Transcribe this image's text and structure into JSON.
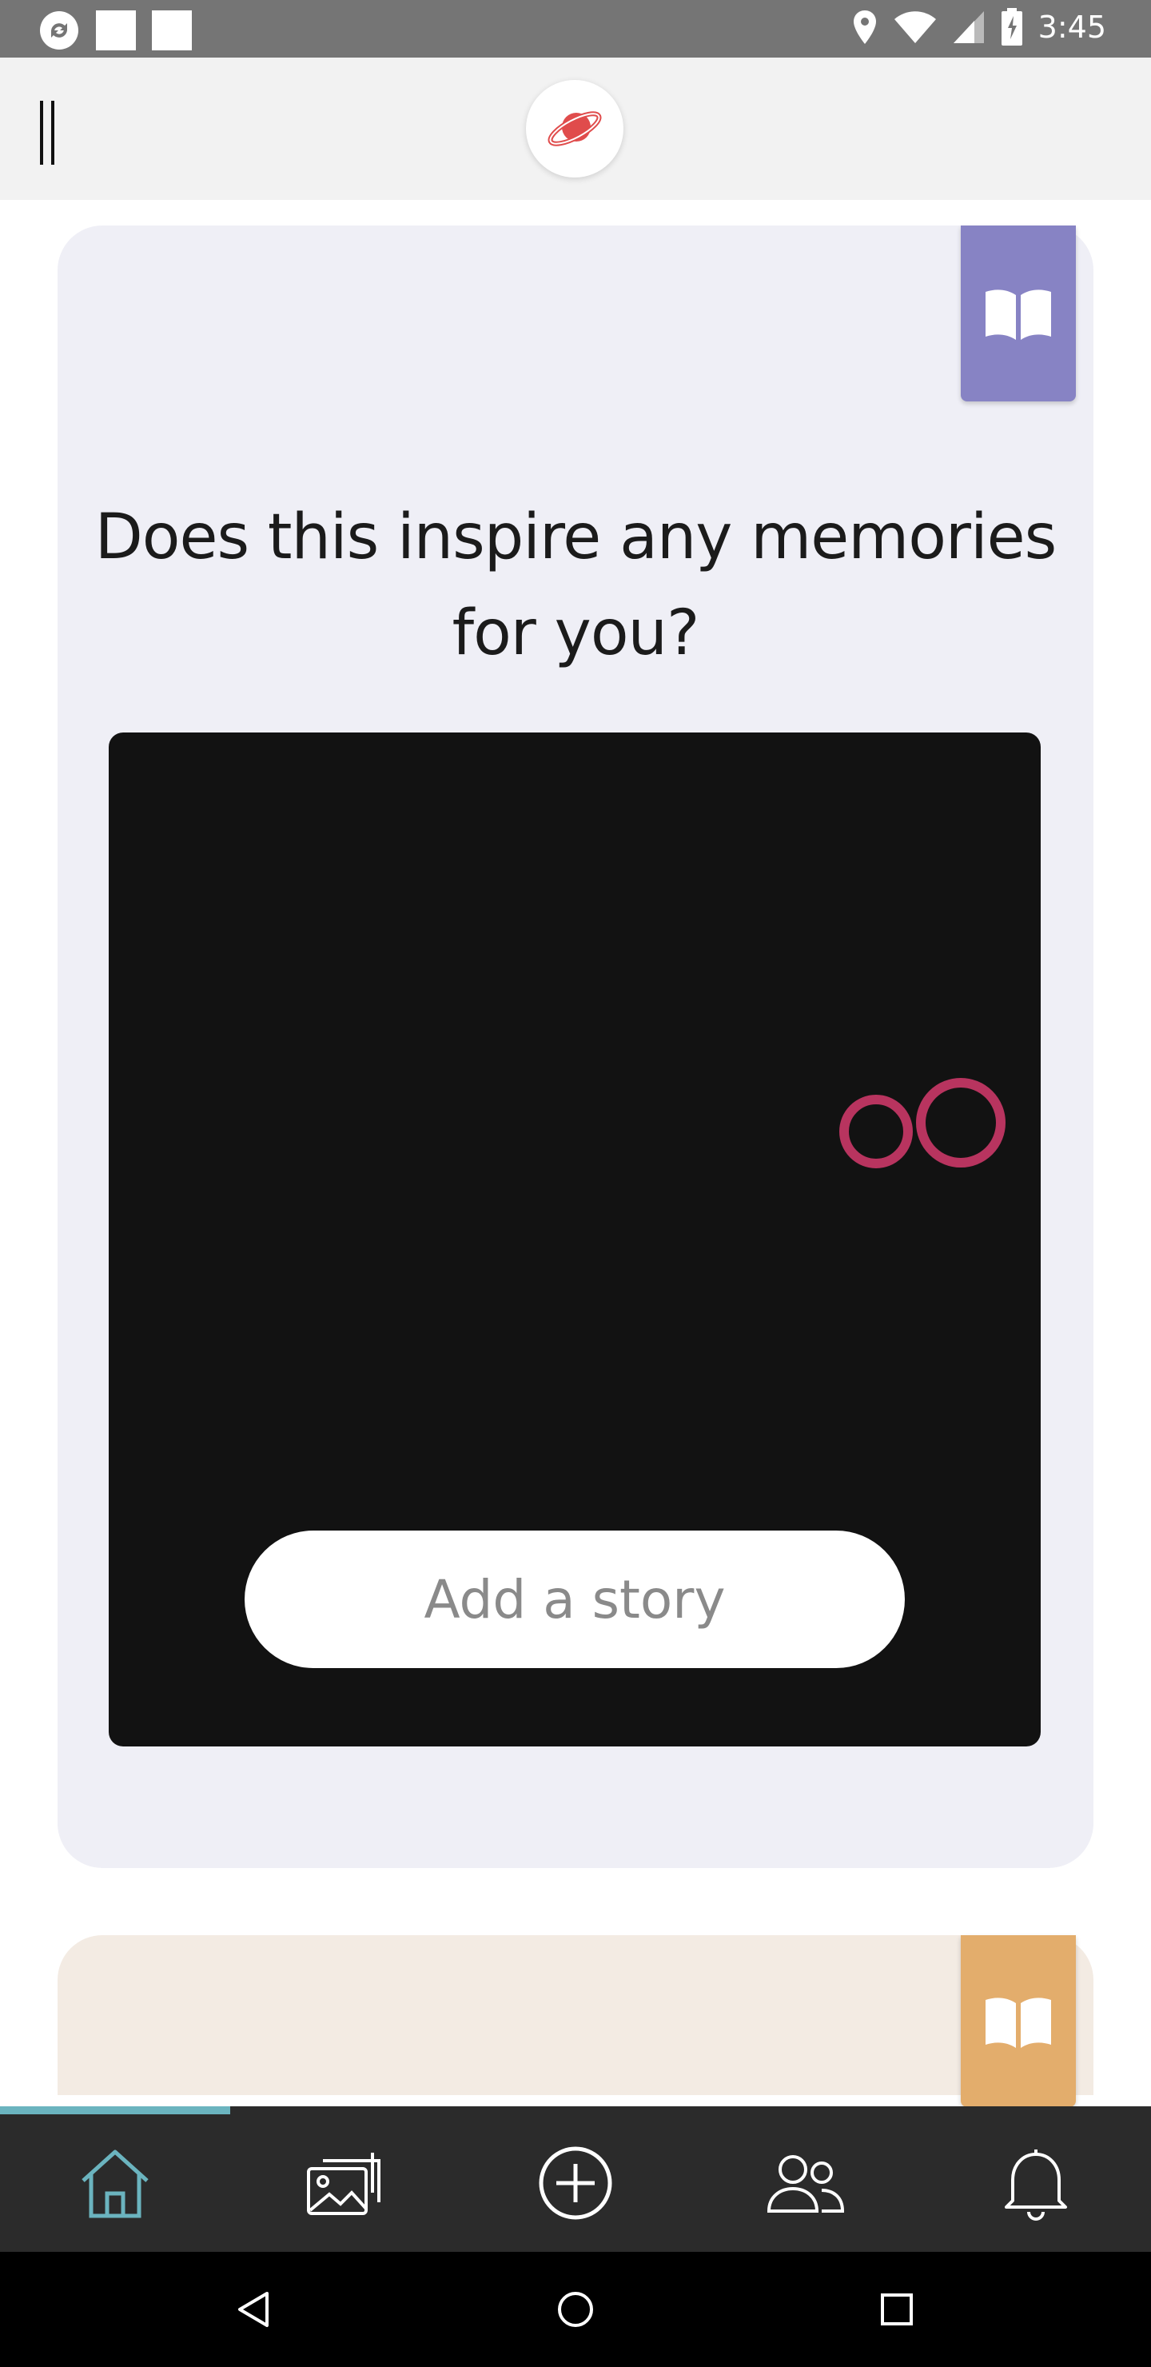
{
  "status_bar": {
    "time": "3:45",
    "icons": [
      "sync-icon",
      "notification-square-icon",
      "notification-square-icon",
      "location-icon",
      "wifi-icon",
      "signal-icon",
      "battery-charging-icon"
    ]
  },
  "header": {
    "menu_icon": "menu-icon",
    "logo_icon": "planet-logo-icon"
  },
  "cards": [
    {
      "background": "#efeff6",
      "tag_color": "#8783c4",
      "tag_icon": "open-book-icon",
      "prompt": "Does this inspire any memories for you?",
      "media_background": "#121212",
      "action_label": "Add a story"
    },
    {
      "background": "#f3ebe3",
      "tag_color": "#e3ad6c",
      "tag_icon": "open-book-icon"
    }
  ],
  "tabbar": {
    "active_index": 0,
    "accent": "#6bb4bf",
    "tabs": [
      {
        "icon": "home-icon",
        "active": true
      },
      {
        "icon": "gallery-icon",
        "active": false
      },
      {
        "icon": "add-circle-icon",
        "active": false
      },
      {
        "icon": "people-icon",
        "active": false
      },
      {
        "icon": "bell-icon",
        "active": false
      }
    ]
  },
  "navbar": {
    "buttons": [
      "back-icon",
      "home-circle-icon",
      "recents-icon"
    ]
  }
}
